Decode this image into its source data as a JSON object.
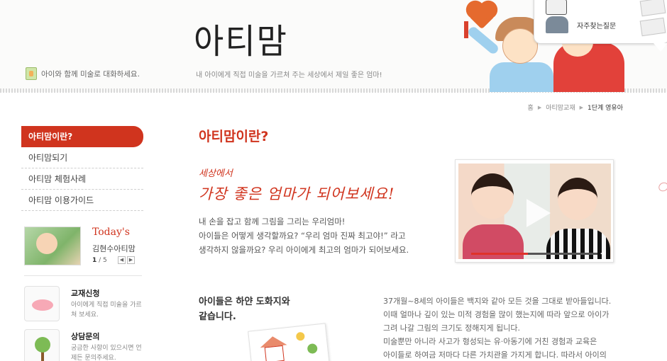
{
  "header": {
    "tagline": "아이와 함께 미술로 대화하세요.",
    "logo": "아티맘",
    "subtitle": "내 아이에게 직접 미술을 가르쳐 주는 세상에서 제일 좋은 엄마!",
    "quick_menu": {
      "faq_label": "자주찾는질문"
    }
  },
  "breadcrumb": [
    "홈",
    "아티맘교재",
    "1단계 영유아"
  ],
  "nav": {
    "items": [
      {
        "label": "아티맘이란?",
        "active": true
      },
      {
        "label": "아티맘되기"
      },
      {
        "label": "아티맘 체험사례"
      },
      {
        "label": "아티맘 이용가이드"
      }
    ]
  },
  "today": {
    "title": "Today's",
    "name": "김현수아티맘",
    "page_current": "1",
    "page_total": "/ 5"
  },
  "quick_links": [
    {
      "title": "교재신청",
      "desc": "아이에게 직접 미술을 가르쳐 보세요."
    },
    {
      "title": "상담문의",
      "desc": "궁금한 사항이 있으시면 언제든 문의주세요."
    }
  ],
  "main": {
    "title": "아티맘이란?",
    "script_small": "세상에서",
    "script_big": "가장 좋은 엄마가 되어보세요!",
    "intro": [
      "내 손을 잡고 함께 그림을 그리는 우리엄마!",
      "아이들은 어떻게 생각할까요? “우리 엄마 진짜 최고야!” 라고",
      "생각하지 않을까요? 우리 아이에게 최고의 엄마가 되어보세요."
    ],
    "video": {
      "progress": 0.45
    },
    "section2_title": [
      "아이들은 하얀 도화지와",
      "같습니다."
    ],
    "section2_text": [
      "37개월~8세의 아이들은 백지와 같아 모든 것을 그대로 받아들입니다.",
      "이때 얼마나 깊이 있는 미적 경험을 많이 했는지에 따라 앞으로 아이가",
      "그려 나갈 그림의 크기도 정해지게 됩니다.",
      "미술뿐만 아니라 사고가 형성되는 유·아동기에 거친 경험과 교육은",
      "아이들로 하여금 저마다 다른 가치관을 가지게 합니다. 따라서 아이의"
    ]
  },
  "colors": {
    "accent": "#d0341e",
    "text": "#555555"
  }
}
